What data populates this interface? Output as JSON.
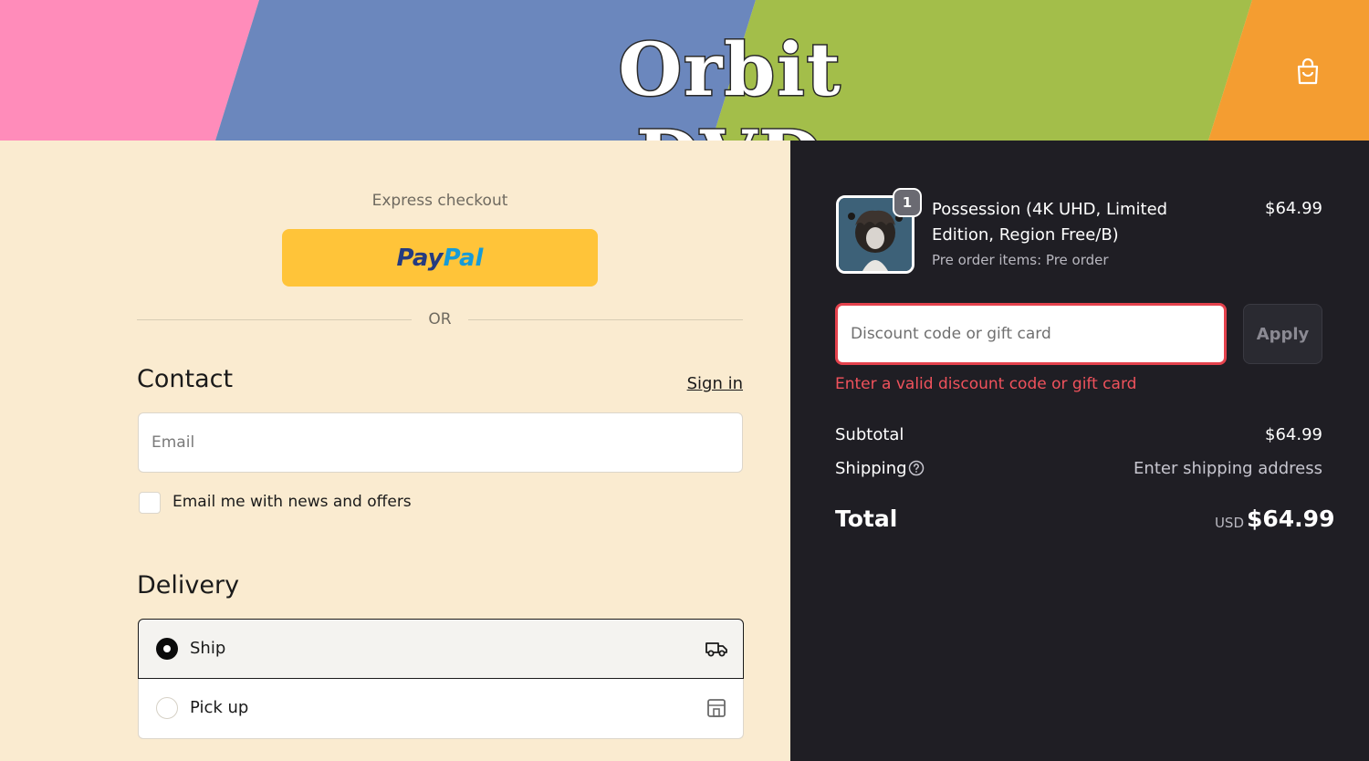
{
  "header": {
    "brand": "Orbit DVD",
    "cart_icon": "shopping-bag-icon",
    "stripe_colors": [
      "#ff8cba",
      "#6b87bd",
      "#a3be4a",
      "#f49d31"
    ]
  },
  "checkout": {
    "express_label": "Express checkout",
    "paypal": {
      "pay": "Pay",
      "pal": "Pal"
    },
    "or_label": "OR",
    "contact": {
      "title": "Contact",
      "sign_in": "Sign in",
      "email_placeholder": "Email",
      "newsletter_label": "Email me with news and offers",
      "newsletter_checked": false
    },
    "delivery": {
      "title": "Delivery",
      "options": [
        {
          "label": "Ship",
          "selected": true,
          "icon": "truck-icon"
        },
        {
          "label": "Pick up",
          "selected": false,
          "icon": "store-icon"
        }
      ]
    }
  },
  "summary": {
    "item": {
      "title": "Possession (4K UHD, Limited Edition, Region Free/B)",
      "meta": "Pre order items: Pre order",
      "price": "$64.99",
      "quantity": "1"
    },
    "discount": {
      "placeholder": "Discount code or gift card",
      "apply_label": "Apply",
      "error": "Enter a valid discount code or gift card"
    },
    "subtotal_label": "Subtotal",
    "subtotal_value": "$64.99",
    "shipping_label": "Shipping",
    "shipping_value": "Enter shipping address",
    "total_label": "Total",
    "currency": "USD",
    "total_value": "$64.99"
  },
  "colors": {
    "left_bg": "#faebd0",
    "right_bg": "#1f1e24",
    "paypal_yellow": "#ffc439",
    "error_red": "#f0525c"
  }
}
